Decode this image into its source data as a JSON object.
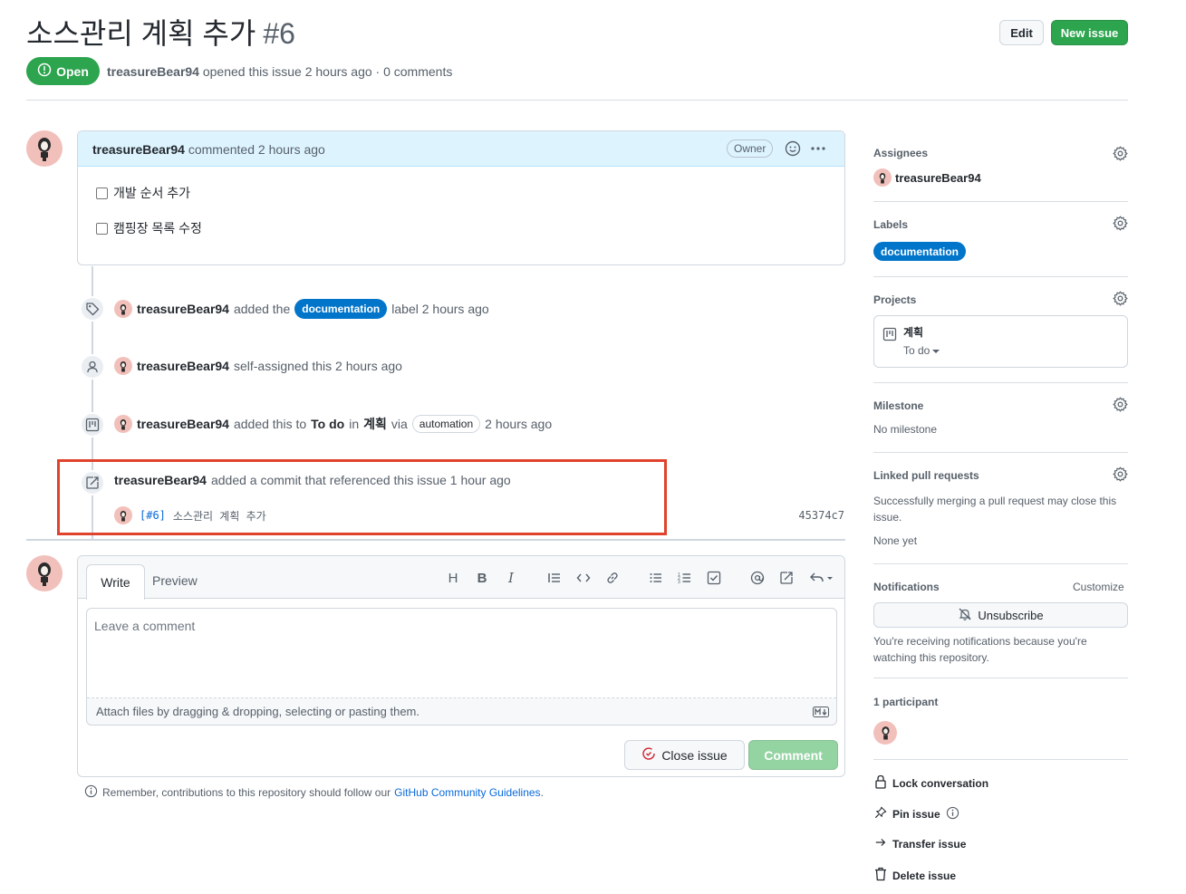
{
  "issue": {
    "title": "소스관리 계획 추가",
    "number": "#6",
    "state": "Open",
    "author": "treasureBear94",
    "opened_text": "opened this issue 2 hours ago · 0 comments"
  },
  "header_buttons": {
    "edit": "Edit",
    "new_issue": "New issue"
  },
  "comment": {
    "author": "treasureBear94",
    "action": "commented 2 hours ago",
    "badge": "Owner",
    "tasks": [
      "개발 순서 추가",
      "캠핑장 목록 수정"
    ]
  },
  "timeline": {
    "label_event": {
      "author": "treasureBear94",
      "pre": "added the",
      "label": "documentation",
      "post": "label 2 hours ago"
    },
    "assign_event": {
      "author": "treasureBear94",
      "text": "self-assigned this 2 hours ago"
    },
    "project_event": {
      "author": "treasureBear94",
      "pre": "added this to",
      "column": "To do",
      "in": "in",
      "project": "계획",
      "via": "via",
      "bot": "automation",
      "time": "2 hours ago"
    },
    "commit_event": {
      "author": "treasureBear94",
      "text": "added a commit that referenced this issue 1 hour ago",
      "ref": "[#6]",
      "message": "소스관리 계획 추가",
      "sha": "45374c7"
    }
  },
  "editor": {
    "tab_write": "Write",
    "tab_preview": "Preview",
    "placeholder": "Leave a comment",
    "attach_text": "Attach files by dragging & dropping, selecting or pasting them.",
    "close_button": "Close issue",
    "comment_button": "Comment",
    "guidelines_pre": "Remember, contributions to this repository should follow our",
    "guidelines_link": "GitHub Community Guidelines",
    "guidelines_post": "."
  },
  "sidebar": {
    "assignees": {
      "heading": "Assignees",
      "user": "treasureBear94"
    },
    "labels": {
      "heading": "Labels",
      "label": "documentation"
    },
    "projects": {
      "heading": "Projects",
      "name": "계획",
      "column": "To do"
    },
    "milestone": {
      "heading": "Milestone",
      "value": "No milestone"
    },
    "linked": {
      "heading": "Linked pull requests",
      "text": "Successfully merging a pull request may close this issue.",
      "value": "None yet"
    },
    "notifications": {
      "heading": "Notifications",
      "customize": "Customize",
      "button": "Unsubscribe",
      "text": "You're receiving notifications because you're watching this repository."
    },
    "participants": {
      "heading": "1 participant"
    },
    "actions": {
      "lock": "Lock conversation",
      "pin": "Pin issue",
      "transfer": "Transfer issue",
      "delete": "Delete issue"
    }
  },
  "colors": {
    "green": "#2da44e",
    "label_blue": "#0075ca",
    "highlight_red": "#e0432c",
    "link": "#0969da"
  }
}
